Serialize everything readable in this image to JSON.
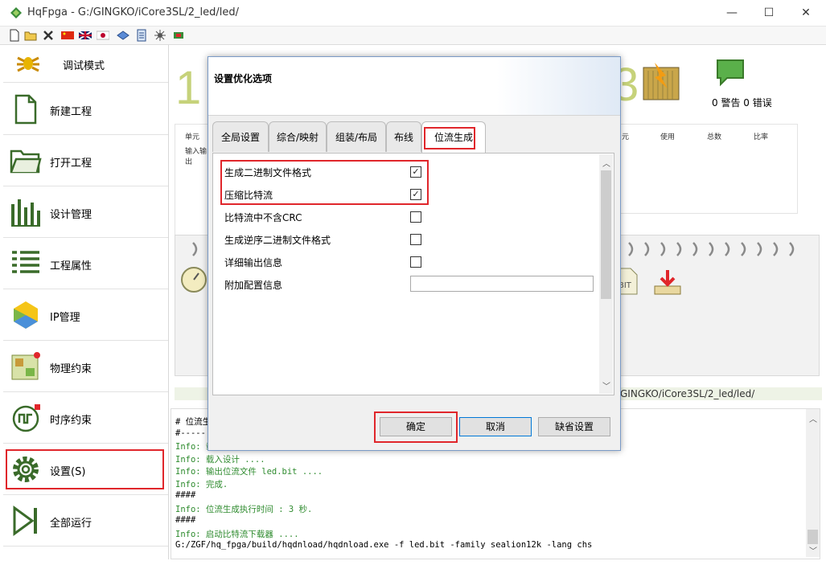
{
  "window": {
    "title": "HqFpga - G:/GINGKO/iCore3SL/2_led/led/",
    "minimize": "—",
    "maximize": "☐",
    "close": "✕"
  },
  "sidebar": {
    "items": [
      {
        "label": "调试模式",
        "icon": "debug-bug-icon"
      },
      {
        "label": "新建工程",
        "icon": "new-file-icon"
      },
      {
        "label": "打开工程",
        "icon": "open-folder-icon"
      },
      {
        "label": "设计管理",
        "icon": "design-manage-icon"
      },
      {
        "label": "工程属性",
        "icon": "project-properties-icon"
      },
      {
        "label": "IP管理",
        "icon": "ip-manage-icon"
      },
      {
        "label": "物理约束",
        "icon": "physical-constraint-icon"
      },
      {
        "label": "时序约束",
        "icon": "timing-constraint-icon"
      },
      {
        "label": "设置(S)",
        "icon": "gear-icon"
      },
      {
        "label": "全部运行",
        "icon": "run-all-icon"
      }
    ]
  },
  "main": {
    "step_number": "1",
    "step_number_right": "3",
    "warnings": "0 警告 0 错误",
    "table_headers_left": [
      "单元",
      "输入输出"
    ],
    "table_headers_right": [
      "元",
      "使用",
      "总数",
      "比率"
    ],
    "path_text": "GINGKO/iCore3SL/2_led/led/",
    "bit_label": "BIT"
  },
  "log": {
    "lines": [
      {
        "text": "# 位流生",
        "color": "#000000"
      },
      {
        "text": "#-----",
        "color": "#000000"
      },
      {
        "text": "Info: 载",
        "color": "#2e8b2e"
      },
      {
        "text": "Info: 载入设计 ....",
        "color": "#2e8b2e"
      },
      {
        "text": "Info: 输出位流文件 led.bit ....",
        "color": "#2e8b2e"
      },
      {
        "text": "Info: 完成.",
        "color": "#2e8b2e"
      },
      {
        "text": "####",
        "color": "#000000"
      },
      {
        "text": "Info: 位流生成执行时间 : 3 秒.",
        "color": "#2e8b2e"
      },
      {
        "text": "####",
        "color": "#000000"
      },
      {
        "text": "Info: 启动比特流下载器 ....",
        "color": "#2e8b2e"
      },
      {
        "text": "G:/ZGF/hq_fpga/build/hqdnload/hqdnload.exe -f led.bit -family sealion12k -lang chs",
        "color": "#000000"
      }
    ]
  },
  "dialog": {
    "title": "设置优化选项",
    "tabs": [
      "全局设置",
      "综合/映射",
      "组装/布局",
      "布线",
      "位流生成"
    ],
    "active_tab": 4,
    "options": [
      {
        "label": "生成二进制文件格式",
        "checked": true
      },
      {
        "label": "压缩比特流",
        "checked": true
      },
      {
        "label": "比特流中不含CRC",
        "checked": false
      },
      {
        "label": "生成逆序二进制文件格式",
        "checked": false
      },
      {
        "label": "详细输出信息",
        "checked": false
      },
      {
        "label": "附加配置信息",
        "type": "text",
        "value": ""
      }
    ],
    "buttons": {
      "ok": "确定",
      "cancel": "取消",
      "defaults": "缺省设置"
    }
  },
  "colors": {
    "highlight": "#e0262b",
    "accent": "#0078d7"
  }
}
